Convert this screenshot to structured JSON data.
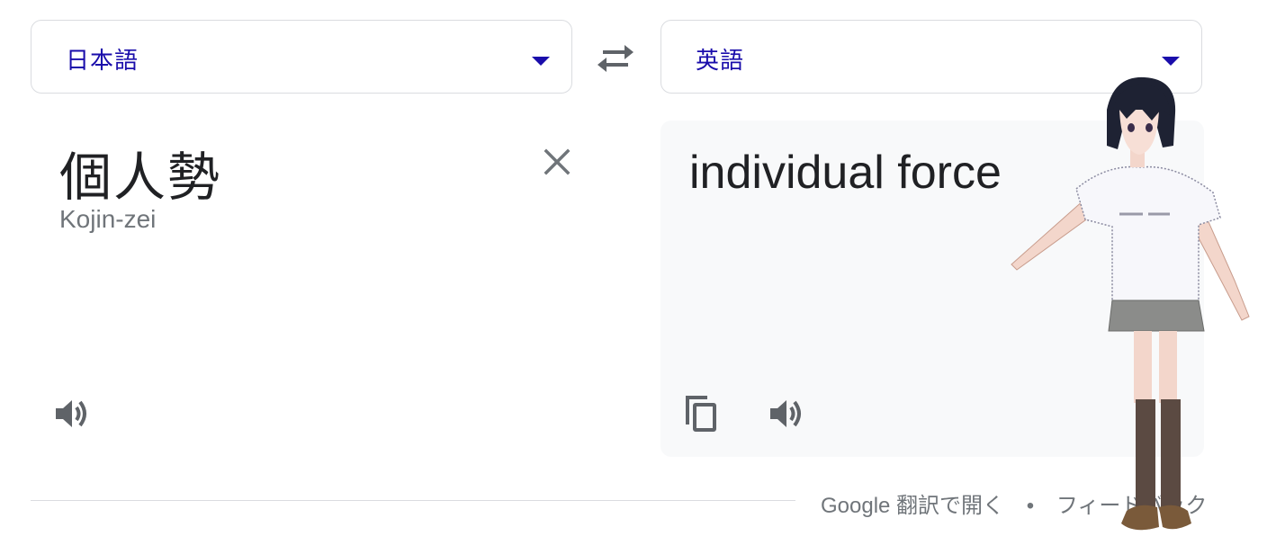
{
  "source": {
    "language": "日本語",
    "text": "個人勢",
    "romanization": "Kojin-zei"
  },
  "target": {
    "language": "英語",
    "text": "individual force"
  },
  "footer": {
    "open_link": "Google 翻訳で開く",
    "separator": "•",
    "feedback_link": "フィードバック"
  },
  "colors": {
    "language_label": "#1a0dab",
    "icon_gray": "#5f6368",
    "panel_bg": "#f8f9fa",
    "border": "#dadce0"
  },
  "icons": {
    "swap": "swap-arrows-icon",
    "clear": "close-icon",
    "source_speak": "speaker-icon",
    "copy": "copy-icon",
    "target_speak": "speaker-icon"
  }
}
